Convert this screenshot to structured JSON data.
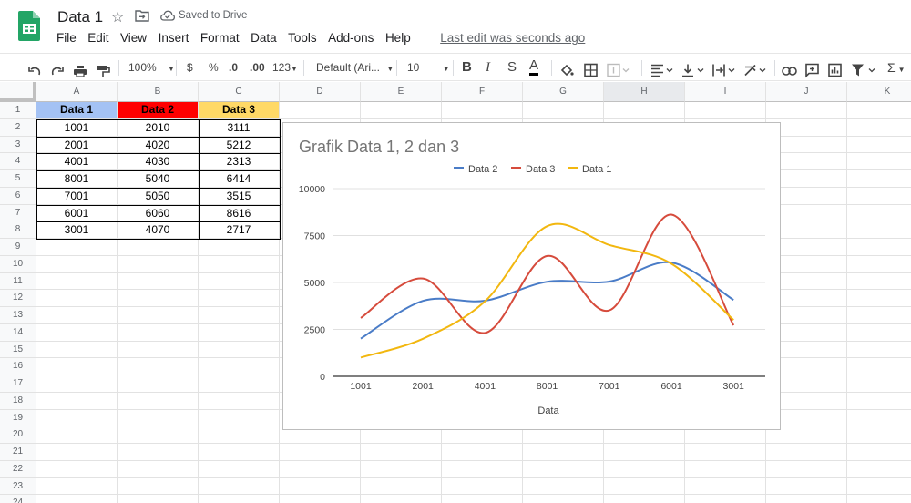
{
  "app": {
    "title": "Data 1",
    "saved_status": "Saved to Drive",
    "menu": [
      "File",
      "Edit",
      "View",
      "Insert",
      "Format",
      "Data",
      "Tools",
      "Add-ons",
      "Help"
    ],
    "last_edit": "Last edit was seconds ago"
  },
  "toolbar": {
    "zoom": "100%",
    "currency": "$",
    "percent": "%",
    "dec_decrease": ".0",
    "dec_increase": ".00",
    "more_formats": "123",
    "font": "Default (Ari...",
    "font_size": "10",
    "bold": "B",
    "italic": "I",
    "strike": "S",
    "text_color": "A",
    "sum": "Σ"
  },
  "sheet": {
    "columns": [
      "A",
      "B",
      "C",
      "D",
      "E",
      "F",
      "G",
      "H",
      "I",
      "J",
      "K"
    ],
    "rows": [
      "1",
      "2",
      "3",
      "4",
      "5",
      "6",
      "7",
      "8",
      "9",
      "10",
      "11",
      "12",
      "13",
      "14",
      "15",
      "16",
      "17",
      "18",
      "19",
      "20",
      "21",
      "22",
      "23",
      "24"
    ],
    "header_cells": [
      "Data 1",
      "Data 2",
      "Data 3"
    ],
    "header_colors": [
      "#a4c2f4",
      "#ff0000",
      "#ffd966"
    ],
    "data": [
      [
        "1001",
        "2010",
        "3111"
      ],
      [
        "2001",
        "4020",
        "5212"
      ],
      [
        "4001",
        "4030",
        "2313"
      ],
      [
        "8001",
        "5040",
        "6414"
      ],
      [
        "7001",
        "5050",
        "3515"
      ],
      [
        "6001",
        "6060",
        "8616"
      ],
      [
        "3001",
        "4070",
        "2717"
      ]
    ]
  },
  "chart_data": {
    "type": "line",
    "title": "Grafik Data 1, 2 dan 3",
    "xlabel": "Data",
    "ylabel": "",
    "categories": [
      "1001",
      "2001",
      "4001",
      "8001",
      "7001",
      "6001",
      "3001"
    ],
    "ylim": [
      0,
      10000
    ],
    "yticks": [
      "0",
      "2500",
      "5000",
      "7500",
      "10000"
    ],
    "smooth": true,
    "legend_position": "top",
    "grid": true,
    "series": [
      {
        "name": "Data 2",
        "color": "#4a7cc7",
        "values": [
          2010,
          4020,
          4030,
          5040,
          5050,
          6060,
          4070
        ]
      },
      {
        "name": "Data 3",
        "color": "#d64b3c",
        "values": [
          3111,
          5212,
          2313,
          6414,
          3515,
          8616,
          2717
        ]
      },
      {
        "name": "Data 1",
        "color": "#f2b70f",
        "values": [
          1001,
          2001,
          4001,
          8001,
          7001,
          6001,
          3001
        ]
      }
    ]
  }
}
